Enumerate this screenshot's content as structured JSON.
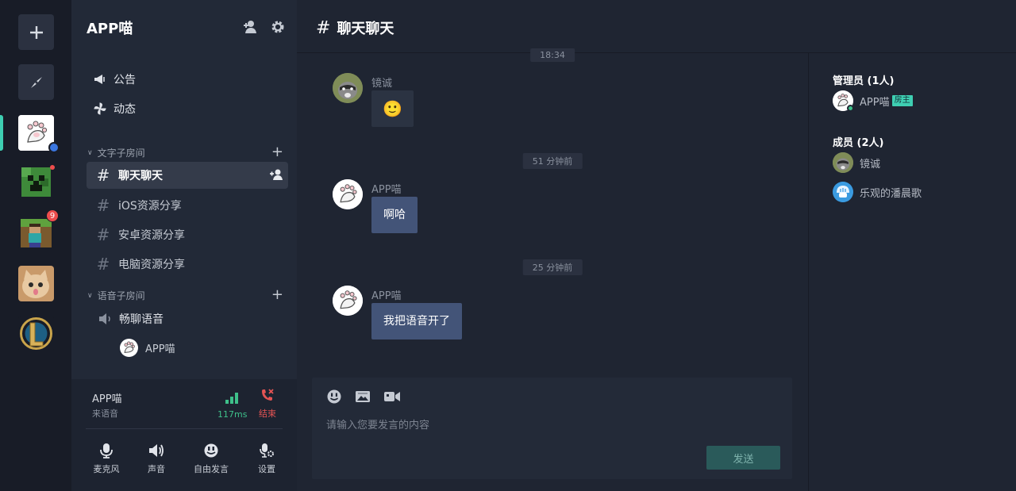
{
  "rail": {
    "add_label": "+",
    "badge_count": "9",
    "servers": [
      "paw-server",
      "creeper-server",
      "minecraft-server",
      "cat-server",
      "league-server"
    ]
  },
  "sidebar": {
    "server_name": "APP喵",
    "nav": [
      {
        "label": "公告",
        "icon": "megaphone-icon"
      },
      {
        "label": "动态",
        "icon": "pinwheel-icon"
      }
    ],
    "text_category": "文字子房间",
    "text_channels": [
      {
        "label": "聊天聊天",
        "active": true
      },
      {
        "label": "iOS资源分享"
      },
      {
        "label": "安卓资源分享"
      },
      {
        "label": "电脑资源分享"
      }
    ],
    "voice_category": "语音子房间",
    "voice_channel": "畅聊语音",
    "voice_user": "APP喵",
    "hash_glyph": "#"
  },
  "voice_panel": {
    "name": "APP喵",
    "status": "来语音",
    "ping": "117ms",
    "end_label": "结束",
    "controls": [
      {
        "label": "麦克风",
        "icon": "microphone-icon"
      },
      {
        "label": "声音",
        "icon": "speaker-icon"
      },
      {
        "label": "自由发言",
        "icon": "free-speak-icon"
      },
      {
        "label": "设置",
        "icon": "mic-settings-icon"
      }
    ]
  },
  "chat": {
    "title": "聊天聊天",
    "hash_glyph": "#",
    "top_time": "18:34",
    "messages": [
      {
        "author": "镜诚",
        "text": "🙂",
        "time": ""
      },
      {
        "author": "APP喵",
        "text": "啊哈",
        "time": "51 分钟前"
      },
      {
        "author": "APP喵",
        "text": "我把语音开了",
        "time": "25 分钟前"
      }
    ],
    "composer": {
      "placeholder": "请输入您要发言的内容",
      "send_label": "发送"
    }
  },
  "members": {
    "admin_group": "管理员 (1人)",
    "admins": [
      {
        "name": "APP喵",
        "tag": "房主"
      }
    ],
    "member_group": "成员 (2人)",
    "members": [
      {
        "name": "镜诚"
      },
      {
        "name": "乐观的潘晨歌"
      }
    ]
  },
  "colors": {
    "accent": "#3ecfb2",
    "bubble": "#435478",
    "danger": "#e55454",
    "online": "#3ec08a"
  }
}
